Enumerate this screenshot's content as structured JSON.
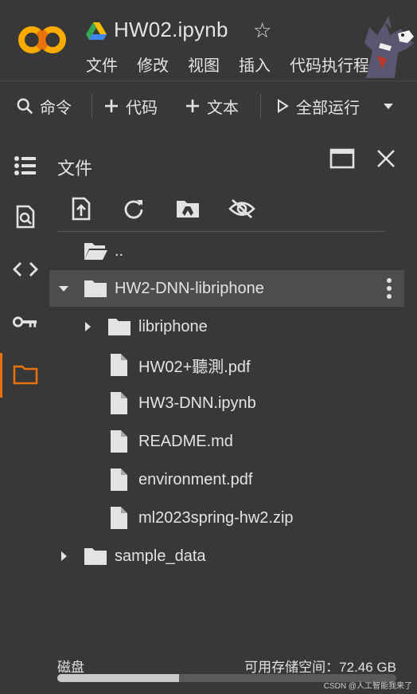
{
  "app": {
    "logo_text": "CO",
    "title": "HW02.ipynb",
    "star_glyph": "☆",
    "menu": [
      "文件",
      "修改",
      "视图",
      "插入",
      "代码执行程序"
    ]
  },
  "toolbar": {
    "command_label": "命令",
    "add_code_label": "代码",
    "add_text_label": "文本",
    "run_all_label": "全部运行"
  },
  "panel": {
    "title": "文件",
    "parent_dir": ".."
  },
  "files": [
    {
      "name": "HW2-DNN-libriphone",
      "type": "folder",
      "level": 1,
      "expanded": true,
      "selected": true
    },
    {
      "name": "libriphone",
      "type": "folder",
      "level": 2,
      "expanded": false
    },
    {
      "name": "HW02+聽測.pdf",
      "type": "file",
      "level": 2
    },
    {
      "name": "HW3-DNN.ipynb",
      "type": "file",
      "level": 2
    },
    {
      "name": "README.md",
      "type": "file",
      "level": 2
    },
    {
      "name": "environment.pdf",
      "type": "file",
      "level": 2
    },
    {
      "name": "ml2023spring-hw2.zip",
      "type": "file",
      "level": 2
    },
    {
      "name": "sample_data",
      "type": "folder",
      "level": 1,
      "expanded": false
    }
  ],
  "disk": {
    "label": "磁盘",
    "available": "可用存储空间：72.46 GB",
    "used_fraction": 0.36
  },
  "watermark": "CSDN @人工智能我来了",
  "colors": {
    "background": "#383838",
    "accent_orange": "#e8710a",
    "logo_orange": "#f9ab00",
    "text": "#e3e3e3"
  }
}
